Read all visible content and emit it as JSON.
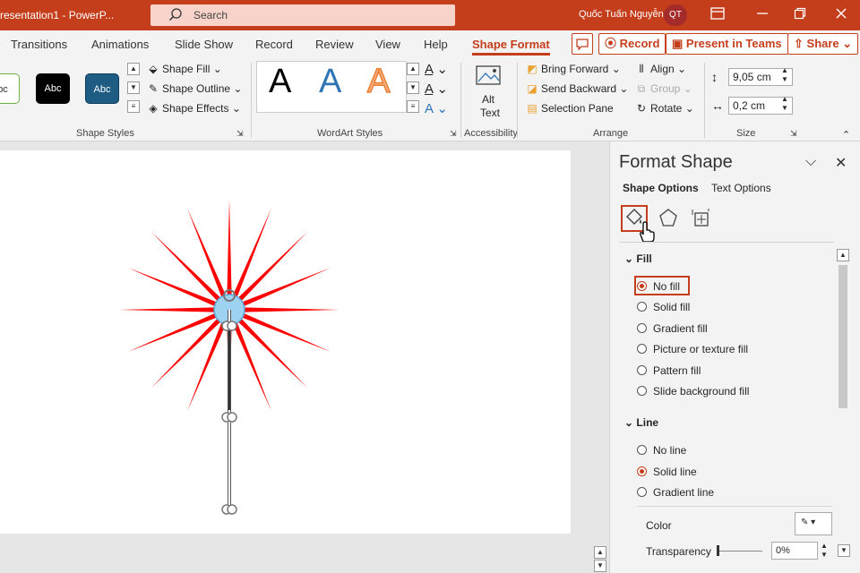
{
  "titlebar": {
    "doc_title": "resentation1  -  PowerP...",
    "search_placeholder": "Search",
    "user_name": "Quốc Tuấn Nguyễn",
    "user_initials": "QT"
  },
  "tabs": [
    "Transitions",
    "Animations",
    "Slide Show",
    "Record",
    "Review",
    "View",
    "Help",
    "Shape Format"
  ],
  "active_tab": "Shape Format",
  "top_buttons": {
    "record": "Record",
    "present": "Present in Teams",
    "share": "Share"
  },
  "ribbon": {
    "shape_styles": {
      "swatches": [
        "bc",
        "Abc",
        "Abc"
      ],
      "shape_fill": "Shape Fill",
      "shape_outline": "Shape Outline",
      "shape_effects": "Shape Effects",
      "group_label": "Shape Styles"
    },
    "wordart": {
      "letters": [
        "A",
        "A",
        "A"
      ],
      "group_label": "WordArt Styles"
    },
    "accessibility": {
      "alt_text_1": "Alt",
      "alt_text_2": "Text",
      "group_label": "Accessibility"
    },
    "arrange": {
      "bring_forward": "Bring Forward",
      "send_backward": "Send Backward",
      "selection_pane": "Selection Pane",
      "align": "Align",
      "group": "Group",
      "rotate": "Rotate",
      "group_label": "Arrange"
    },
    "size": {
      "height": "9,05 cm",
      "width": "0,2 cm",
      "group_label": "Size"
    }
  },
  "panel": {
    "title": "Format Shape",
    "tab_shape": "Shape Options",
    "tab_text": "Text Options",
    "fill": {
      "header": "Fill",
      "options": [
        "No fill",
        "Solid fill",
        "Gradient fill",
        "Picture or texture fill",
        "Pattern fill",
        "Slide background fill"
      ],
      "selected": "No fill"
    },
    "line": {
      "header": "Line",
      "options": [
        "No line",
        "Solid line",
        "Gradient line"
      ],
      "selected": "Solid line"
    },
    "color_label": "Color",
    "transparency_label": "Transparency",
    "transparency_value": "0%"
  },
  "colors": {
    "accent": "#c43e1c",
    "star_ray": "#ff0000",
    "style_dark_blue": "#1f5c84"
  }
}
